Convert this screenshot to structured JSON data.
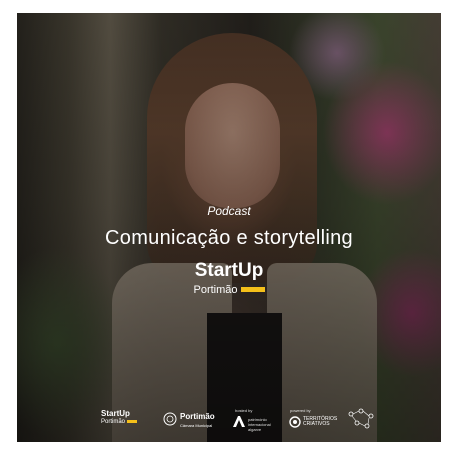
{
  "podcast_label": "Podcast",
  "title": "Comunicação e storytelling",
  "brand": {
    "name": "StartUp",
    "sub": "Portimão",
    "accent": "#f5c01a"
  },
  "partners": {
    "startup": {
      "name": "StartUp",
      "sub": "Portimão"
    },
    "municipio": {
      "name": "Portimão",
      "sub": "Câmara Municipal"
    },
    "hosted_by": "hosted by",
    "host_sub": "património internacional algarve",
    "powered_by": "powered by",
    "territorios": "TERRITÓRIOS",
    "criativos": "CRIATIVOS"
  },
  "icons": [
    "municipal-seal-icon",
    "host-logo-icon",
    "territorios-logo-icon",
    "network-logo-icon"
  ]
}
